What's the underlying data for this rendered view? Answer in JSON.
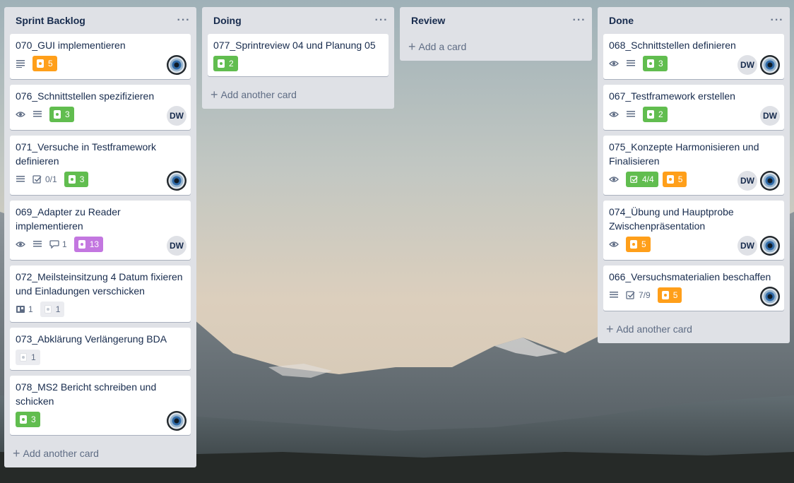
{
  "lists": [
    {
      "title": "Sprint Backlog",
      "add_label": "Add another card",
      "cards": [
        {
          "title": "070_GUI implementieren",
          "label_value": "5"
        },
        {
          "title": "076_Schnittstellen spezifizieren",
          "label_value": "3",
          "member": "DW"
        },
        {
          "title": "071_Versuche in Testframework definieren",
          "checklist": "0/1",
          "label_value": "3"
        },
        {
          "title": "069_Adapter zu Reader implementieren",
          "comments": "1",
          "label_value": "13",
          "member": "DW"
        },
        {
          "title": "072_Meilsteinsitzung 4 Datum fixieren und Einladungen verschicken",
          "attachments": "1",
          "label_value": "1"
        },
        {
          "title": "073_Abklärung Verlängerung BDA",
          "label_value": "1"
        },
        {
          "title": "078_MS2 Bericht schreiben und schicken",
          "label_value": "3"
        }
      ]
    },
    {
      "title": "Doing",
      "add_label": "Add another card",
      "cards": [
        {
          "title": "077_Sprintreview 04 und Planung 05",
          "label_value": "2"
        }
      ]
    },
    {
      "title": "Review",
      "add_label": "Add a card",
      "cards": []
    },
    {
      "title": "Done",
      "add_label": "Add another card",
      "cards": [
        {
          "title": "068_Schnittstellen definieren",
          "label_value": "3",
          "member": "DW"
        },
        {
          "title": "067_Testframework erstellen",
          "label_value": "2",
          "member": "DW"
        },
        {
          "title": "075_Konzepte Harmonisieren und Finalisieren",
          "checklist": "4/4",
          "label_value": "5",
          "member": "DW"
        },
        {
          "title": "074_Übung und Hauptprobe Zwischenpräsentation",
          "label_value": "5",
          "member": "DW"
        },
        {
          "title": "066_Versuchsmaterialien beschaffen",
          "checklist": "7/9",
          "label_value": "5"
        }
      ]
    }
  ],
  "menu_glyph": "···",
  "plus_glyph": "+",
  "colors": {
    "orange": "#ff9f1a",
    "green": "#61bd4f",
    "purple": "#c377e0",
    "list_bg": "#dfe1e6"
  }
}
